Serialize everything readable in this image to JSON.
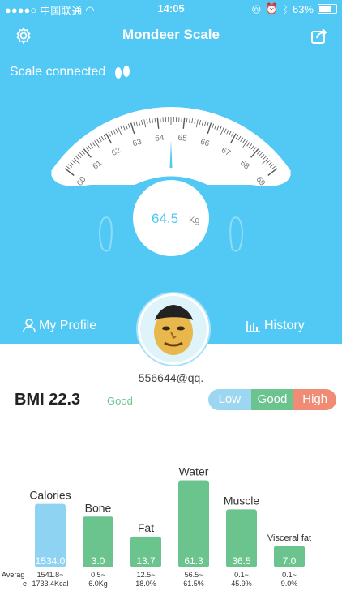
{
  "status_bar": {
    "carrier": "中国联通",
    "time": "14:05",
    "battery": "63%"
  },
  "header": {
    "title": "Mondeer Scale"
  },
  "connection": {
    "label": "Scale connected"
  },
  "gauge": {
    "ticks": [
      "60",
      "61",
      "62",
      "63",
      "64",
      "65",
      "66",
      "67",
      "68",
      "69"
    ],
    "value": "64.5",
    "unit": "Kg"
  },
  "tabs": {
    "profile": "My Profile",
    "history": "History"
  },
  "user": {
    "name": "556644@qq."
  },
  "bmi": {
    "label": "BMI 22.3",
    "status": "Good",
    "scale": [
      "Low",
      "Good",
      "High"
    ]
  },
  "colors": {
    "primary": "#52c8f5",
    "low": "#9dd6f0",
    "good": "#6bc48e",
    "high": "#f08c75",
    "calories": "#8ed3f2"
  },
  "metrics": {
    "average_label": "Average",
    "items": [
      {
        "name": "Calories",
        "value": "1534.0",
        "range": "1541.8~",
        "range2": "1733.4Kcal",
        "level": 0.7,
        "color": "#8ed3f2"
      },
      {
        "name": "Bone",
        "value": "3.0",
        "range": "0.5~",
        "range2": "6.0Kg",
        "level": 0.56,
        "color": "#6bc48e"
      },
      {
        "name": "Fat",
        "value": "13.7",
        "range": "12.5~",
        "range2": "18.0%",
        "level": 0.34,
        "color": "#6bc48e"
      },
      {
        "name": "Water",
        "value": "61.3",
        "range": "56.5~",
        "range2": "61.5%",
        "level": 0.96,
        "color": "#6bc48e"
      },
      {
        "name": "Muscle",
        "value": "36.5",
        "range": "0.1~",
        "range2": "45.9%",
        "level": 0.64,
        "color": "#6bc48e"
      },
      {
        "name": "Visceral fat",
        "value": "7.0",
        "range": "0.1~",
        "range2": "9.0%",
        "level": 0.24,
        "color": "#6bc48e"
      }
    ]
  }
}
